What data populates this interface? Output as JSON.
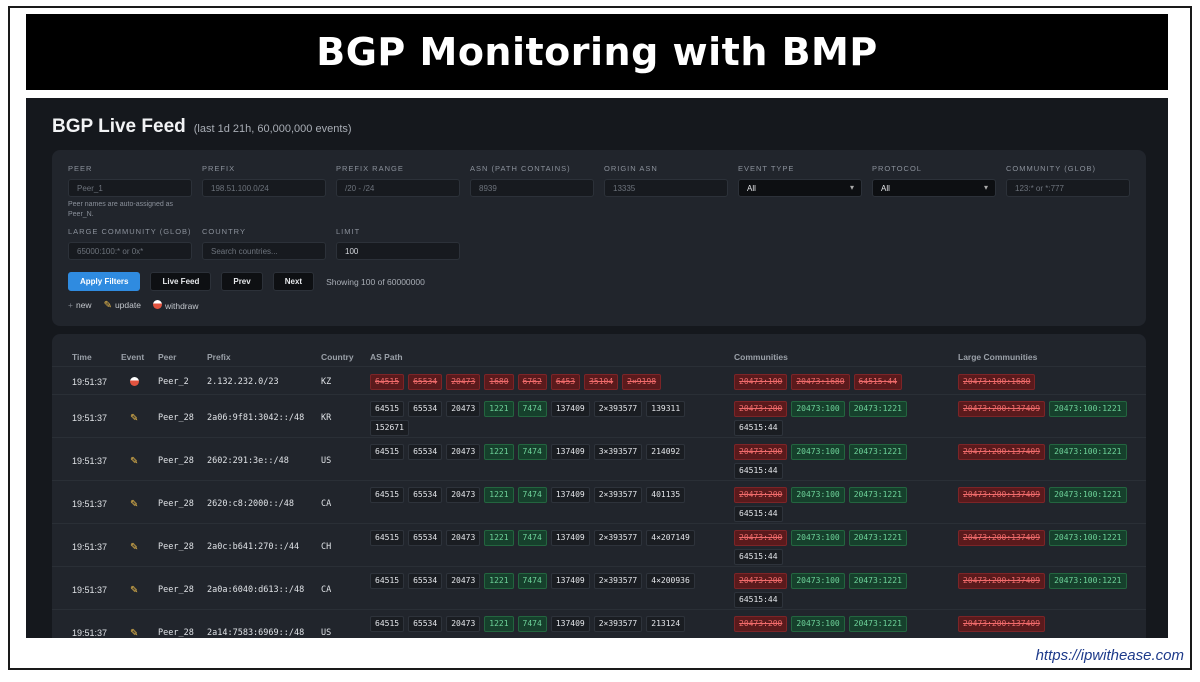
{
  "banner_title": "BGP Monitoring with BMP",
  "app": {
    "title": "BGP Live Feed",
    "subtitle": "(last 1d 21h, 60,000,000 events)"
  },
  "filters": {
    "peer": {
      "label": "PEER",
      "placeholder": "Peer_1"
    },
    "peer_hint": "Peer names are auto-assigned as Peer_N.",
    "prefix": {
      "label": "PREFIX",
      "placeholder": "198.51.100.0/24"
    },
    "prefix_range": {
      "label": "PREFIX RANGE",
      "placeholder": "/20 - /24"
    },
    "asn": {
      "label": "ASN (PATH CONTAINS)",
      "placeholder": "8939"
    },
    "origin_asn": {
      "label": "ORIGIN ASN",
      "placeholder": "13335"
    },
    "event_type": {
      "label": "EVENT TYPE",
      "value": "All"
    },
    "protocol": {
      "label": "PROTOCOL",
      "value": "All"
    },
    "community": {
      "label": "COMMUNITY (GLOB)",
      "placeholder": "123:* or *:777"
    },
    "large_community": {
      "label": "LARGE COMMUNITY (GLOB)",
      "placeholder": "65000:100:* or 0x*"
    },
    "country": {
      "label": "COUNTRY",
      "placeholder": "Search countries..."
    },
    "limit": {
      "label": "LIMIT",
      "value": "100"
    }
  },
  "buttons": {
    "apply": "Apply Filters",
    "live": "Live Feed",
    "prev": "Prev",
    "next": "Next"
  },
  "showing": "Showing 100 of 60000000",
  "legend": {
    "new": "new",
    "update": "update",
    "withdraw": "withdraw"
  },
  "table": {
    "headers": {
      "time": "Time",
      "event": "Event",
      "peer": "Peer",
      "prefix": "Prefix",
      "country": "Country",
      "as_path": "AS Path",
      "communities": "Communities",
      "large_communities": "Large Communities"
    },
    "rows": [
      {
        "time": "19:51:37",
        "event": "withdraw",
        "peer": "Peer_2",
        "prefix": "2.132.232.0/23",
        "country": "KZ",
        "as_path": [
          {
            "t": "64515",
            "c": "red"
          },
          {
            "t": "65534",
            "c": "red"
          },
          {
            "t": "20473",
            "c": "red"
          },
          {
            "t": "1680",
            "c": "red"
          },
          {
            "t": "6762",
            "c": "red"
          },
          {
            "t": "6453",
            "c": "red"
          },
          {
            "t": "35104",
            "c": "red"
          },
          {
            "t": "2×9198",
            "c": "red"
          }
        ],
        "communities": [
          {
            "t": "20473:100",
            "c": "red"
          },
          {
            "t": "20473:1680",
            "c": "red"
          },
          {
            "t": "64515:44",
            "c": "red"
          }
        ],
        "large": [
          {
            "t": "20473:100:1680",
            "c": "red"
          }
        ]
      },
      {
        "time": "19:51:37",
        "event": "update",
        "peer": "Peer_28",
        "prefix": "2a06:9f81:3042::/48",
        "country": "KR",
        "as_path": [
          {
            "t": "64515",
            "c": "plain"
          },
          {
            "t": "65534",
            "c": "plain"
          },
          {
            "t": "20473",
            "c": "plain"
          },
          {
            "t": "1221",
            "c": "green"
          },
          {
            "t": "7474",
            "c": "green"
          },
          {
            "t": "137409",
            "c": "plain"
          },
          {
            "t": "2×393577",
            "c": "plain"
          },
          {
            "t": "139311",
            "c": "plain"
          },
          {
            "t": "152671",
            "c": "plain"
          }
        ],
        "communities": [
          {
            "t": "20473:200",
            "c": "red"
          },
          {
            "t": "20473:100",
            "c": "green"
          },
          {
            "t": "20473:1221",
            "c": "green"
          },
          {
            "t": "64515:44",
            "c": "plain"
          }
        ],
        "large": [
          {
            "t": "20473:200:137409",
            "c": "red"
          },
          {
            "t": "20473:100:1221",
            "c": "green"
          }
        ]
      },
      {
        "time": "19:51:37",
        "event": "update",
        "peer": "Peer_28",
        "prefix": "2602:291:3e::/48",
        "country": "US",
        "as_path": [
          {
            "t": "64515",
            "c": "plain"
          },
          {
            "t": "65534",
            "c": "plain"
          },
          {
            "t": "20473",
            "c": "plain"
          },
          {
            "t": "1221",
            "c": "green"
          },
          {
            "t": "7474",
            "c": "green"
          },
          {
            "t": "137409",
            "c": "plain"
          },
          {
            "t": "3×393577",
            "c": "plain"
          },
          {
            "t": "214092",
            "c": "plain"
          }
        ],
        "communities": [
          {
            "t": "20473:200",
            "c": "red"
          },
          {
            "t": "20473:100",
            "c": "green"
          },
          {
            "t": "20473:1221",
            "c": "green"
          },
          {
            "t": "64515:44",
            "c": "plain"
          }
        ],
        "large": [
          {
            "t": "20473:200:137409",
            "c": "red"
          },
          {
            "t": "20473:100:1221",
            "c": "green"
          }
        ]
      },
      {
        "time": "19:51:37",
        "event": "update",
        "peer": "Peer_28",
        "prefix": "2620:c8:2000::/48",
        "country": "CA",
        "as_path": [
          {
            "t": "64515",
            "c": "plain"
          },
          {
            "t": "65534",
            "c": "plain"
          },
          {
            "t": "20473",
            "c": "plain"
          },
          {
            "t": "1221",
            "c": "green"
          },
          {
            "t": "7474",
            "c": "green"
          },
          {
            "t": "137409",
            "c": "plain"
          },
          {
            "t": "2×393577",
            "c": "plain"
          },
          {
            "t": "401135",
            "c": "plain"
          }
        ],
        "communities": [
          {
            "t": "20473:200",
            "c": "red"
          },
          {
            "t": "20473:100",
            "c": "green"
          },
          {
            "t": "20473:1221",
            "c": "green"
          },
          {
            "t": "64515:44",
            "c": "plain"
          }
        ],
        "large": [
          {
            "t": "20473:200:137409",
            "c": "red"
          },
          {
            "t": "20473:100:1221",
            "c": "green"
          }
        ]
      },
      {
        "time": "19:51:37",
        "event": "update",
        "peer": "Peer_28",
        "prefix": "2a0c:b641:270::/44",
        "country": "CH",
        "as_path": [
          {
            "t": "64515",
            "c": "plain"
          },
          {
            "t": "65534",
            "c": "plain"
          },
          {
            "t": "20473",
            "c": "plain"
          },
          {
            "t": "1221",
            "c": "green"
          },
          {
            "t": "7474",
            "c": "green"
          },
          {
            "t": "137409",
            "c": "plain"
          },
          {
            "t": "2×393577",
            "c": "plain"
          },
          {
            "t": "4×207149",
            "c": "plain"
          }
        ],
        "communities": [
          {
            "t": "20473:200",
            "c": "red"
          },
          {
            "t": "20473:100",
            "c": "green"
          },
          {
            "t": "20473:1221",
            "c": "green"
          },
          {
            "t": "64515:44",
            "c": "plain"
          }
        ],
        "large": [
          {
            "t": "20473:200:137409",
            "c": "red"
          },
          {
            "t": "20473:100:1221",
            "c": "green"
          }
        ]
      },
      {
        "time": "19:51:37",
        "event": "update",
        "peer": "Peer_28",
        "prefix": "2a0a:6040:d613::/48",
        "country": "CA",
        "as_path": [
          {
            "t": "64515",
            "c": "plain"
          },
          {
            "t": "65534",
            "c": "plain"
          },
          {
            "t": "20473",
            "c": "plain"
          },
          {
            "t": "1221",
            "c": "green"
          },
          {
            "t": "7474",
            "c": "green"
          },
          {
            "t": "137409",
            "c": "plain"
          },
          {
            "t": "2×393577",
            "c": "plain"
          },
          {
            "t": "4×200936",
            "c": "plain"
          }
        ],
        "communities": [
          {
            "t": "20473:200",
            "c": "red"
          },
          {
            "t": "20473:100",
            "c": "green"
          },
          {
            "t": "20473:1221",
            "c": "green"
          },
          {
            "t": "64515:44",
            "c": "plain"
          }
        ],
        "large": [
          {
            "t": "20473:200:137409",
            "c": "red"
          },
          {
            "t": "20473:100:1221",
            "c": "green"
          }
        ]
      },
      {
        "time": "19:51:37",
        "event": "update",
        "peer": "Peer_28",
        "prefix": "2a14:7583:6969::/48",
        "country": "US",
        "as_path": [
          {
            "t": "64515",
            "c": "plain"
          },
          {
            "t": "65534",
            "c": "plain"
          },
          {
            "t": "20473",
            "c": "plain"
          },
          {
            "t": "1221",
            "c": "green"
          },
          {
            "t": "7474",
            "c": "green"
          },
          {
            "t": "137409",
            "c": "plain"
          },
          {
            "t": "2×393577",
            "c": "plain"
          },
          {
            "t": "213124",
            "c": "plain"
          }
        ],
        "communities": [
          {
            "t": "20473:200",
            "c": "red"
          },
          {
            "t": "20473:100",
            "c": "green"
          },
          {
            "t": "20473:1221",
            "c": "green"
          }
        ],
        "large": [
          {
            "t": "20473:200:137409",
            "c": "red"
          }
        ]
      }
    ]
  },
  "watermark": "https://ipwithease.com"
}
